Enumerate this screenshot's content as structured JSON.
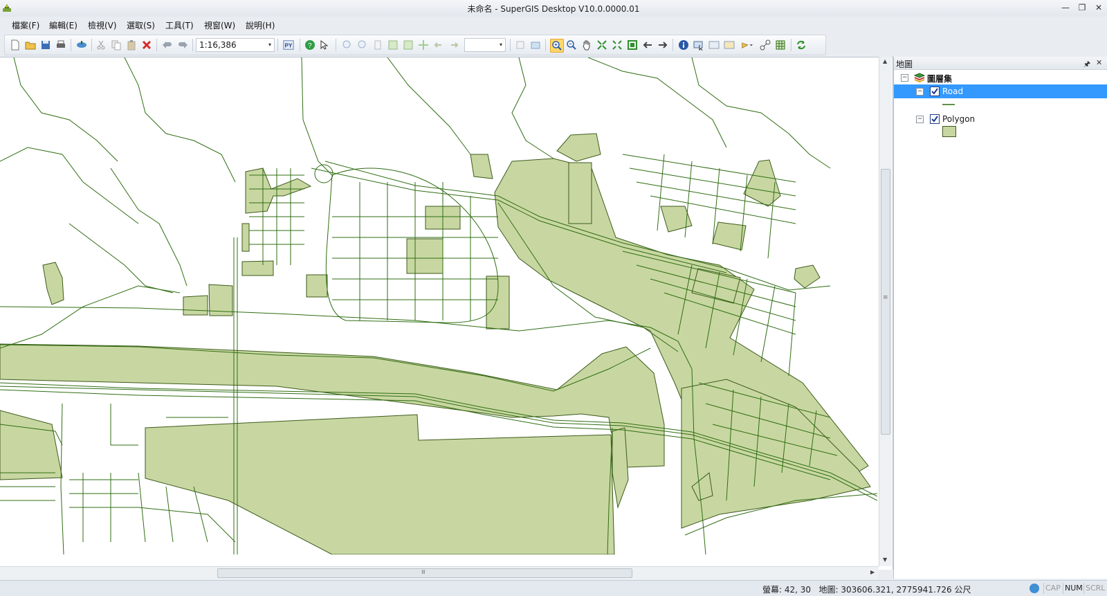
{
  "app": {
    "title": "未命名 - SuperGIS Desktop V10.0.0000.01"
  },
  "window_controls": {
    "minimize": "—",
    "restore": "❐",
    "close": "✕"
  },
  "menu": [
    "檔案(F)",
    "編輯(E)",
    "檢視(V)",
    "選取(S)",
    "工具(T)",
    "視窗(W)",
    "說明(H)"
  ],
  "toolbar": {
    "scale": "1:16,386",
    "python_label": "PY",
    "scale_arrow": "▾",
    "blank_combo_arrow": "▾"
  },
  "colors": {
    "road": "#2f6d12",
    "polygon_fill": "#c8d7a1",
    "polygon_stroke": "#3c5a1a",
    "selection": "#3399ff"
  },
  "panel": {
    "title": "地圖",
    "pin": "🖈",
    "close": "✕",
    "root": "圖層集",
    "layers": [
      {
        "name": "Road",
        "checked": true,
        "selected": true,
        "symbol": "line"
      },
      {
        "name": "Polygon",
        "checked": true,
        "selected": false,
        "symbol": "fill"
      }
    ]
  },
  "status": {
    "screen_coords": "螢幕: 42, 30",
    "map_coords": "地圖: 303606.321, 2775941.726 公尺",
    "cap": "CAP",
    "num": "NUM",
    "scrl": "SCRL"
  },
  "scroll": {
    "grip": "≡"
  }
}
